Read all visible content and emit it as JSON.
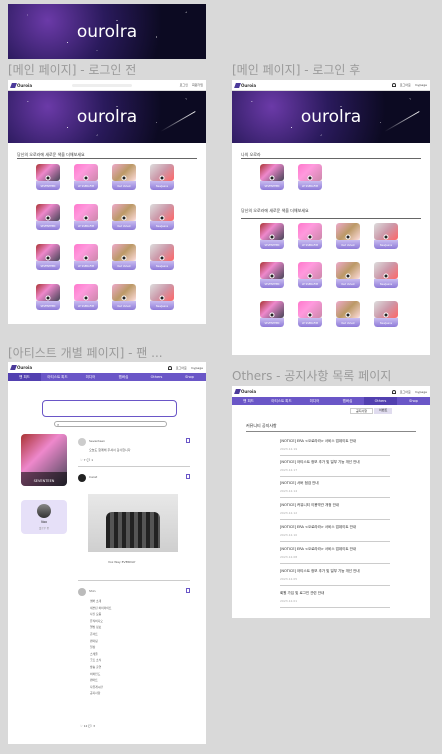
{
  "top_banner": {
    "title": "ourolra"
  },
  "frames": {
    "main_logged_out": {
      "label": "[메인 페이지] - 로그인 전"
    },
    "main_logged_in": {
      "label": "[메인 페이지] - 로그인 후"
    },
    "artist_page": {
      "label": "[아티스트 개별 페이지] - 팬 ..."
    },
    "notice_list": {
      "label": "Others - 공지사항 목록 페이지"
    }
  },
  "common": {
    "logo_text": "Ouroia",
    "login_link": "로그인",
    "signup_link": "회원가입",
    "login_status": "로그아웃",
    "mypage_link": "mypage",
    "banner_title": "ourolra"
  },
  "main": {
    "recommend_title": "당신의 오로라에 새로운 색을 더해보세요",
    "my_aurora_title": "나의 오로라",
    "colors": {
      "accent": "#6a56c7",
      "label_gradient_top": "#c9bdf0",
      "label_gradient_bottom": "#8e7ad8"
    },
    "artist_names": [
      "SEVENTEEN",
      "LE SSERAFIM",
      "Red Velvet",
      "NewJeans",
      "SEVENTEEN",
      "LE SSERAFIM",
      "Red Velvet",
      "NewJeans",
      "SEVENTEEN",
      "LE SSERAFIM",
      "Red Velvet",
      "NewJeans",
      "SEVENTEEN",
      "LE SSERAFIM",
      "Red Velvet",
      "NewJeans"
    ]
  },
  "artist_page": {
    "nav": [
      "팬 피드",
      "아티스트 피드",
      "미디어",
      "멤버십",
      "Others",
      "Shop"
    ],
    "artist_name": "SEVENTEEN",
    "member_name": "Vox",
    "member_sub": "팔로우 중",
    "post1_author": "Seventeen",
    "post1_text": "오늘도 함께해 주셔서 감사합니다",
    "post1_stats": "♡ 7   💬 1",
    "post2_author": "Carat",
    "post2_caption": "Vox Way EVERDAY",
    "post3_author": "Shin",
    "comment_lines": [
      "멤버 소개",
      "세븐틴 하이라이트",
      "사진 모음",
      "뮤직비디오",
      "앨범 정보",
      "콘서트",
      "팬미팅",
      "일상",
      "스케줄",
      "굿즈 소식",
      "방송 출연",
      "비하인드",
      "팬아트",
      "자유게시판",
      "공지사항"
    ],
    "post3_stats": "♡ 12   💬 3"
  },
  "notice": {
    "nav": [
      "팬 피드",
      "아티스트 피드",
      "미디어",
      "멤버십",
      "Others",
      "Shop"
    ],
    "sub_tabs": [
      "공지사항",
      "이벤트"
    ],
    "title": "커뮤니티 공지사항",
    "items": [
      {
        "title": "[NOTICE] ERA <오로라라> 서비스 업데이트 안내",
        "date": "2023.12.19"
      },
      {
        "title": "[NOTICE] 아티스트 정보 추가 및 일부 기능 개선 안내",
        "date": "2023.12.17"
      },
      {
        "title": "[NOTICE] 서버 점검 안내",
        "date": "2023.12.14"
      },
      {
        "title": "[NOTICE] 커뮤니티 이용약관 개정 안내",
        "date": "2023.12.12"
      },
      {
        "title": "[NOTICE] ERA <오로라라> 서비스 업데이트 안내",
        "date": "2023.12.10"
      },
      {
        "title": "[NOTICE] ERA <오로라라> 서비스 업데이트 안내",
        "date": "2023.12.08"
      },
      {
        "title": "[NOTICE] 아티스트 정보 추가 및 일부 기능 개선 안내",
        "date": "2023.12.05"
      },
      {
        "title": "회원 가입 및 로그인 관련 안내",
        "date": "2023.12.01"
      }
    ]
  }
}
